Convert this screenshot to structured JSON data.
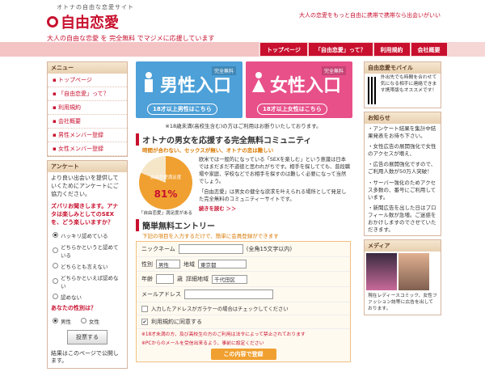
{
  "header": {
    "tagline": "オトナの自由な恋愛サイト",
    "logo": "自由恋愛",
    "subtitle": "大人の自由な恋愛 を 完全無料 でマジメに応援しています",
    "right_text": "大人の恋愛をもっと自由に携帯で携帯なら出会いがいい"
  },
  "nav": [
    "トップページ",
    "「自由恋愛」って？",
    "利用規約",
    "会社概要"
  ],
  "menu": {
    "title": "メニュー",
    "items": [
      "トップページ",
      "「自由恋愛」って？",
      "利用規約",
      "会社概要",
      "男性メンバー登録",
      "女性メンバー登録"
    ]
  },
  "survey": {
    "title": "アンケート",
    "intro": "より良い出会いを提供していくためにアンケートにご協力ください。",
    "question": "ズバリお聞きします。アナタは楽しみとしてのSEXを、どう楽しいますか？",
    "options": [
      "ハッキリ認めている",
      "どちらかというと認めている",
      "どちらとも言えない",
      "どちらかといえば認めない",
      "認めない"
    ],
    "gender_q": "あなたの性別は？",
    "genders": [
      "男性",
      "女性"
    ],
    "submit": "投票する",
    "note": "結果はこのページで公開します。"
  },
  "entry": {
    "male": {
      "label": "男性入口",
      "tag": "完全無料",
      "sub": "18才以上男性はこちら",
      "color": "#4da0d8"
    },
    "female": {
      "label": "女性入口",
      "tag": "完全無料",
      "sub": "18才以上女性はこちら",
      "color": "#e8508a"
    },
    "note": "※18歳未満(高校生含む)の方はご利用はお断りいたしております。"
  },
  "community": {
    "title": "オトナの男女を応援する完全無料コミュニティ",
    "sub": "時間が合わない、セックスが無い、オトナの恋は難しい",
    "pie_label": "自由恋愛満足度",
    "pie_value": "81%",
    "pie_caption": "「自由恋愛」満足度がある",
    "body": "欧米では一般的になっている「SEXを楽しむ」という意識は日本ではまだまだ不道徳と思われがちです。相手を探してても、普段職場や家庭、学校などでお相手を探すのは難しく必要になって当然でしょう。",
    "body2": "「自由恋愛」は男女の健全な欲求を叶えられる場所として発足した完全無料のコミュニティーサイトです。",
    "more": "続きを読む ＞＞"
  },
  "reg": {
    "title": "簡単無料エントリー",
    "sub": "下記の項目を入力するだけで、簡単に会員登録ができます",
    "nickname": "ニックネーム",
    "nick_hint": "(全角15文字以内)",
    "gender": "性別",
    "gender_val": "男性",
    "area": "地域",
    "area_val": "東京都",
    "age": "年齢",
    "age_unit": "歳",
    "detail": "詳細地域",
    "detail_val": "千代田区",
    "mail": "メールアドレス",
    "mail_check": "入力したアドレスがガラケーの場合はチェックしてください",
    "agree": "利用規約に同意する",
    "warn1": "※18才未満の方、及び高校生の方のご利用は法令によって禁止されております",
    "warn2": "※PCからのメールを受信出来るよう、事前に設定ください",
    "submit": "この内容で登録"
  },
  "mobile": {
    "title": "自由恋愛モバイル",
    "text": "外出先でも時間を合わせて気になる相手に連絡できます携帯版もオススメです！"
  },
  "news": {
    "title": "お知らせ",
    "items": [
      "アンケート結果を集計中結果発表をお待ち下さい。",
      "女性広告の展開強化で女性のアクセスが増え、",
      "広告の展開強化ですので、ご利用人数が50万人突破！",
      "サーバー強化のためアクセス多数の、番号にご利用しています。",
      "新聞広告を出した日はプロフィール数が急増。ご迷惑をおかけしますのでさせていただきます。"
    ]
  },
  "media": {
    "title": "メディア",
    "text": "現在レディースコミック、女性ファッション誌等に広告を出しております。"
  }
}
